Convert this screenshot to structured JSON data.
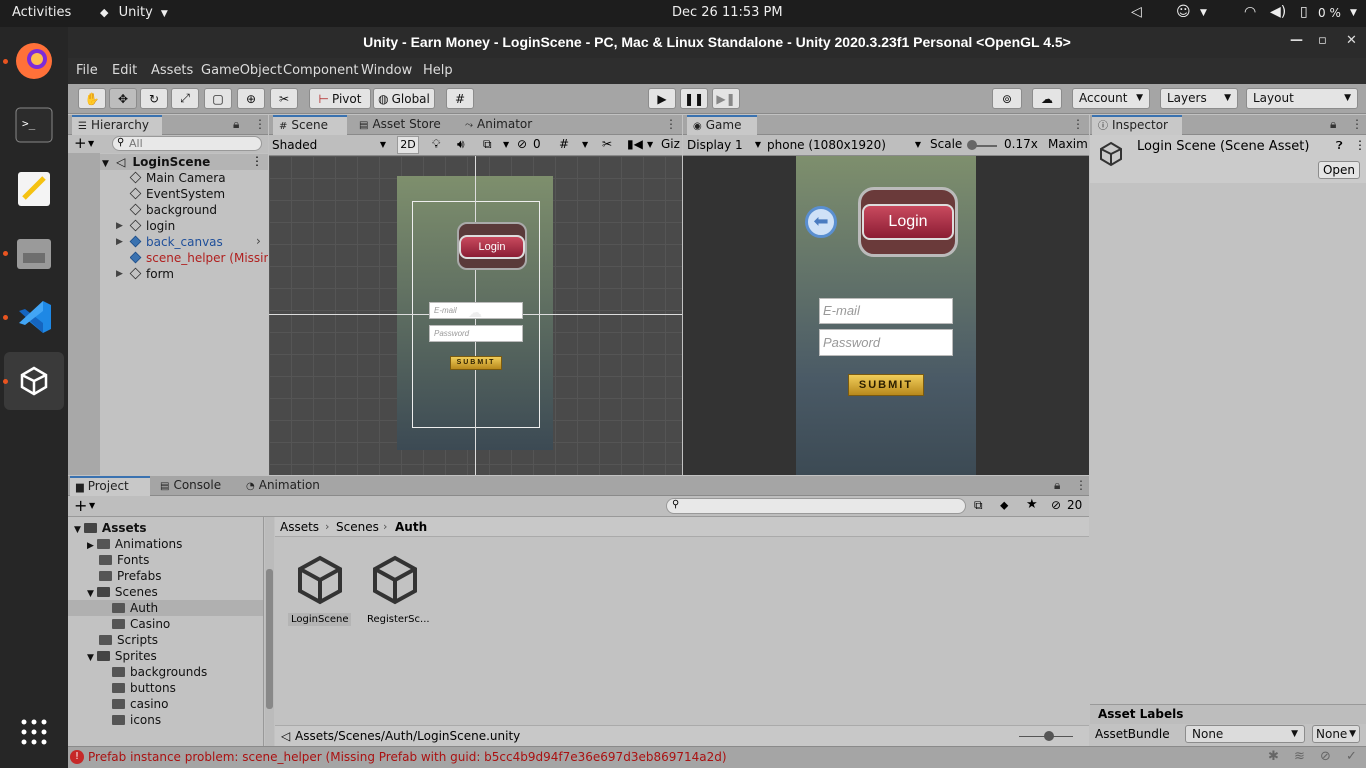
{
  "topbar": {
    "activities": "Activities",
    "app_name": "Unity",
    "datetime": "Dec 26  11:53 PM",
    "battery": "0 %"
  },
  "window": {
    "title": "Unity - Earn Money - LoginScene - PC, Mac & Linux Standalone - Unity 2020.3.23f1 Personal <OpenGL 4.5>"
  },
  "menu": [
    "File",
    "Edit",
    "Assets",
    "GameObject",
    "Component",
    "Window",
    "Help"
  ],
  "toolbar": {
    "pivot": "Pivot",
    "global": "Global",
    "account": "Account",
    "layers": "Layers",
    "layout": "Layout"
  },
  "hierarchy": {
    "tab": "Hierarchy",
    "search_placeholder": "All",
    "scene": "LoginScene",
    "items": [
      "Main Camera",
      "EventSystem",
      "background",
      "login",
      "back_canvas",
      "scene_helper (Missing",
      "form"
    ]
  },
  "scene": {
    "tabs": [
      "Scene",
      "Asset Store",
      "Animator"
    ],
    "shading": "Shaded",
    "mode2d": "2D",
    "hidden_count": "0",
    "gizmos": "Giz",
    "login_label": "Login",
    "email_placeholder": "E-mail",
    "password_placeholder": "Password",
    "submit_label": "SUBMIT"
  },
  "game": {
    "tab": "Game",
    "display": "Display 1",
    "resolution": "phone (1080x1920)",
    "scale_label": "Scale",
    "scale_value": "0.17x",
    "maximize": "Maximi",
    "login_label": "Login",
    "email_placeholder": "E-mail",
    "password_placeholder": "Password",
    "submit_label": "SUBMIT"
  },
  "inspector": {
    "tab": "Inspector",
    "asset_title": "Login Scene (Scene Asset)",
    "open_label": "Open",
    "asset_labels": "Asset Labels",
    "asset_bundle_label": "AssetBundle",
    "asset_bundle_value": "None",
    "asset_bundle_variant": "None"
  },
  "project": {
    "tabs": [
      "Project",
      "Console",
      "Animation"
    ],
    "hidden_count": "20",
    "breadcrumb": [
      "Assets",
      "Scenes",
      "Auth"
    ],
    "tree": [
      {
        "label": "Assets",
        "level": 0,
        "open": true
      },
      {
        "label": "Animations",
        "level": 1,
        "open": false,
        "arrow": true
      },
      {
        "label": "Fonts",
        "level": 1
      },
      {
        "label": "Prefabs",
        "level": 1
      },
      {
        "label": "Scenes",
        "level": 1,
        "open": true
      },
      {
        "label": "Auth",
        "level": 2,
        "selected": true
      },
      {
        "label": "Casino",
        "level": 2
      },
      {
        "label": "Scripts",
        "level": 1
      },
      {
        "label": "Sprites",
        "level": 1,
        "open": true
      },
      {
        "label": "backgrounds",
        "level": 2
      },
      {
        "label": "buttons",
        "level": 2
      },
      {
        "label": "casino",
        "level": 2
      },
      {
        "label": "icons",
        "level": 2
      }
    ],
    "files": [
      "LoginScene",
      "RegisterSc..."
    ],
    "path": "Assets/Scenes/Auth/LoginScene.unity"
  },
  "status": {
    "message": "Prefab instance problem: scene_helper (Missing Prefab with guid: b5cc4b9d94f7e36e697d3eb869714a2d)"
  }
}
